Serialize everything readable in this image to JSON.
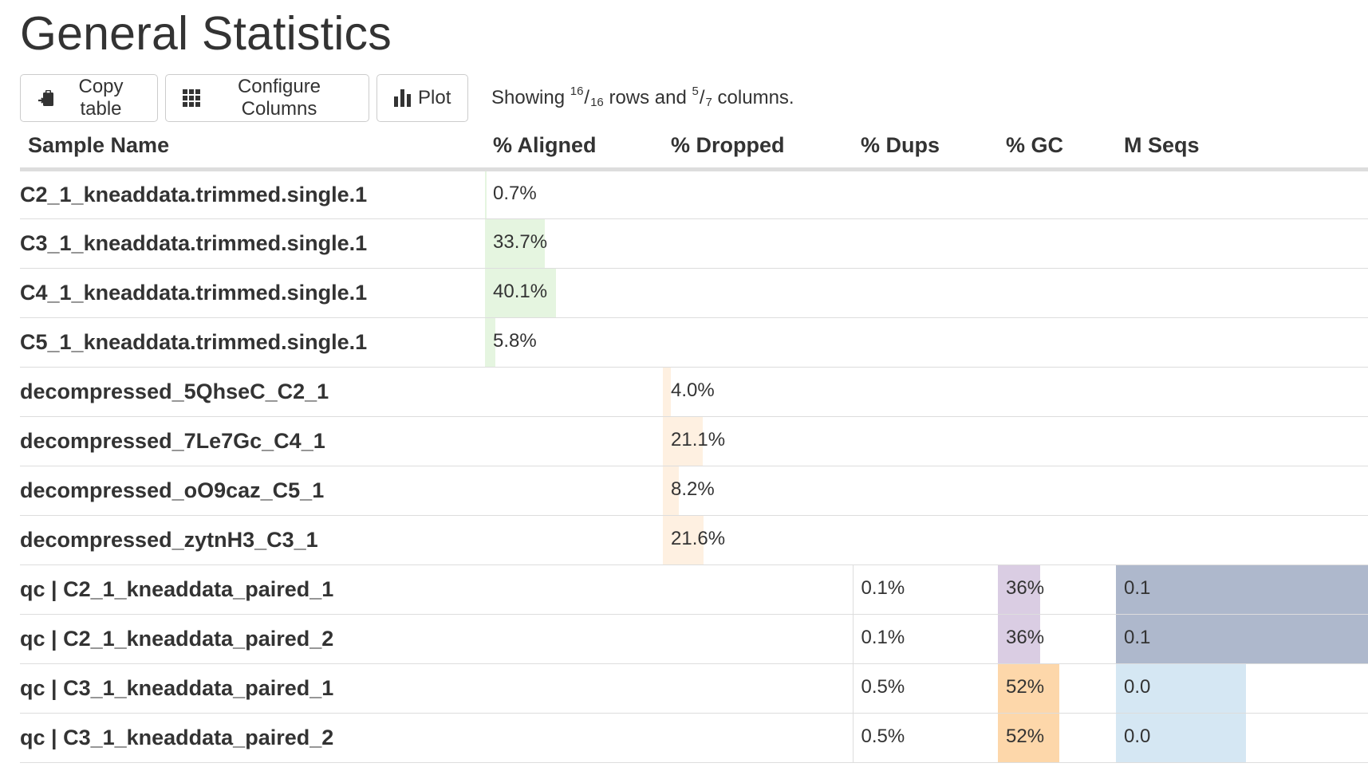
{
  "page": {
    "title": "General Statistics"
  },
  "toolbar": {
    "copy_label": "Copy table",
    "configure_label": "Configure Columns",
    "plot_label": "Plot",
    "showing": {
      "prefix": "Showing",
      "rows_shown": "16",
      "rows_total": "16",
      "middle": "rows and",
      "cols_shown": "5",
      "cols_total": "7",
      "suffix": "columns."
    }
  },
  "colors": {
    "aligned": "#e5f5e0",
    "dropped": "#fef0e1",
    "gc_purple": "#dacde3",
    "gc_orange": "#fdd7aa",
    "mseqs_dark": "#aeb8cc",
    "mseqs_light": "#d5e7f3",
    "border": "#dddddd"
  },
  "table": {
    "headers": {
      "sample": "Sample Name",
      "aligned": "% Aligned",
      "dropped": "% Dropped",
      "dups": "% Dups",
      "gc": "% GC",
      "mseqs": "M Seqs"
    },
    "rows": [
      {
        "name": "C2_1_kneaddata.trimmed.single.1",
        "aligned": "0.7%",
        "aligned_frac": 0.007
      },
      {
        "name": "C3_1_kneaddata.trimmed.single.1",
        "aligned": "33.7%",
        "aligned_frac": 0.337
      },
      {
        "name": "C4_1_kneaddata.trimmed.single.1",
        "aligned": "40.1%",
        "aligned_frac": 0.401
      },
      {
        "name": "C5_1_kneaddata.trimmed.single.1",
        "aligned": "5.8%",
        "aligned_frac": 0.058
      },
      {
        "name": "decompressed_5QhseC_C2_1",
        "dropped": "4.0%",
        "dropped_frac": 0.04
      },
      {
        "name": "decompressed_7Le7Gc_C4_1",
        "dropped": "21.1%",
        "dropped_frac": 0.211
      },
      {
        "name": "decompressed_oO9caz_C5_1",
        "dropped": "8.2%",
        "dropped_frac": 0.082
      },
      {
        "name": "decompressed_zytnH3_C3_1",
        "dropped": "21.6%",
        "dropped_frac": 0.216
      },
      {
        "name": "qc | C2_1_kneaddata_paired_1",
        "dups": "0.1%",
        "gc": "36%",
        "gc_frac": 0.36,
        "gc_color": "gc_purple",
        "mseqs": "0.1",
        "mseqs_frac": 1.0,
        "mseqs_color": "mseqs_dark"
      },
      {
        "name": "qc | C2_1_kneaddata_paired_2",
        "dups": "0.1%",
        "gc": "36%",
        "gc_frac": 0.36,
        "gc_color": "gc_purple",
        "mseqs": "0.1",
        "mseqs_frac": 1.0,
        "mseqs_color": "mseqs_dark"
      },
      {
        "name": "qc | C3_1_kneaddata_paired_1",
        "dups": "0.5%",
        "gc": "52%",
        "gc_frac": 0.52,
        "gc_color": "gc_orange",
        "mseqs": "0.0",
        "mseqs_frac": 0.5,
        "mseqs_color": "mseqs_light"
      },
      {
        "name": "qc | C3_1_kneaddata_paired_2",
        "dups": "0.5%",
        "gc": "52%",
        "gc_frac": 0.52,
        "gc_color": "gc_orange",
        "mseqs": "0.0",
        "mseqs_frac": 0.5,
        "mseqs_color": "mseqs_light"
      }
    ]
  }
}
